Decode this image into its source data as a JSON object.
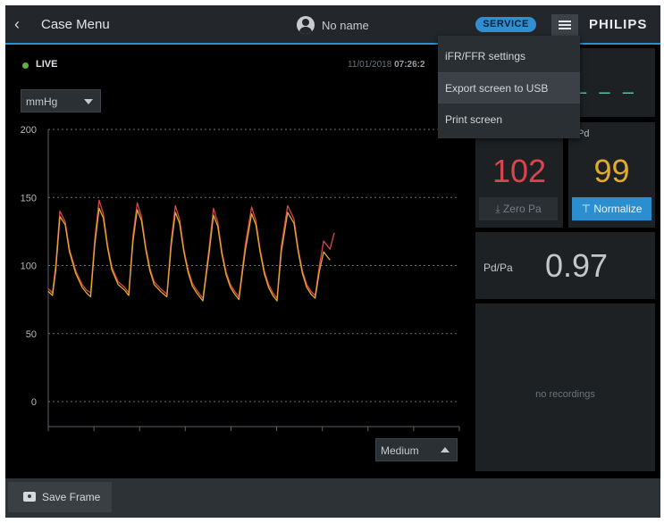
{
  "header": {
    "title": "Case Menu",
    "patient_name": "No name",
    "service_label": "SERVICE",
    "brand": "PHILIPS"
  },
  "status": {
    "live_label": "LIVE",
    "date": "11/01/2018",
    "time": "07:26:2"
  },
  "unit_select": {
    "value": "mmHg"
  },
  "speed_select": {
    "value": "Medium"
  },
  "menu": {
    "items": [
      {
        "label": "iFR/FFR settings"
      },
      {
        "label": "Export screen to USB"
      },
      {
        "label": "Print screen"
      }
    ]
  },
  "panels": {
    "top_value": "– – –",
    "pd_label": "Pd",
    "pa_value": "102",
    "pd_value": "99",
    "zero_button": "Zero Pa",
    "normalize_button": "Normalize",
    "ratio_label": "Pd/Pa",
    "ratio_value": "0.97",
    "recordings_text": "no recordings"
  },
  "footer": {
    "save_frame": "Save Frame"
  },
  "colors": {
    "accent": "#2d8fd0",
    "pa": "#d9454c",
    "pd": "#e1ac2c",
    "live": "#5fb040"
  },
  "chart_data": {
    "type": "line",
    "ylim": [
      0,
      200
    ],
    "yticks": [
      "200",
      "150",
      "100",
      "50",
      "0"
    ],
    "grid": true,
    "series": [
      {
        "color": "#d9454c",
        "x": [
          0,
          0.2,
          0.35,
          0.55,
          0.8,
          1.0,
          1.3,
          1.6,
          1.8,
          2.0,
          2.2,
          2.4,
          2.6,
          2.8,
          3.0,
          3.3,
          3.6,
          3.8,
          4.0,
          4.2,
          4.4,
          4.6,
          4.8,
          5.0,
          5.3,
          5.6,
          5.8,
          6.0,
          6.2,
          6.4,
          6.6,
          6.8,
          7.0,
          7.3,
          7.6,
          7.8,
          8.0,
          8.2,
          8.4,
          8.6,
          8.8,
          9.0,
          9.3,
          9.6,
          9.8,
          10.0,
          10.2,
          10.4,
          10.6,
          10.8,
          11.0,
          11.3,
          11.6,
          11.8,
          12.0,
          12.2,
          12.4,
          12.6,
          12.8,
          13.0,
          13.3,
          13.5
        ],
        "y": [
          83,
          80,
          100,
          140,
          132,
          112,
          96,
          86,
          82,
          80,
          120,
          148,
          138,
          115,
          99,
          88,
          84,
          80,
          122,
          146,
          136,
          114,
          98,
          88,
          83,
          79,
          118,
          144,
          134,
          112,
          97,
          87,
          82,
          76,
          114,
          142,
          132,
          110,
          95,
          86,
          81,
          77,
          115,
          143,
          133,
          112,
          96,
          86,
          80,
          76,
          114,
          144,
          134,
          112,
          96,
          86,
          81,
          78,
          100,
          118,
          112,
          124
        ]
      },
      {
        "color": "#e1ac2c",
        "x": [
          0,
          0.2,
          0.35,
          0.55,
          0.8,
          1.0,
          1.3,
          1.6,
          1.8,
          2.0,
          2.2,
          2.4,
          2.6,
          2.8,
          3.0,
          3.3,
          3.6,
          3.8,
          4.0,
          4.2,
          4.4,
          4.6,
          4.8,
          5.0,
          5.3,
          5.6,
          5.8,
          6.0,
          6.2,
          6.4,
          6.6,
          6.8,
          7.0,
          7.3,
          7.6,
          7.8,
          8.0,
          8.2,
          8.4,
          8.6,
          8.8,
          9.0,
          9.3,
          9.6,
          9.8,
          10.0,
          10.2,
          10.4,
          10.6,
          10.8,
          11.0,
          11.3,
          11.6,
          11.8,
          12.0,
          12.2,
          12.4,
          12.6,
          12.8,
          13.0,
          13.3
        ],
        "y": [
          81,
          78,
          96,
          136,
          130,
          110,
          94,
          84,
          80,
          77,
          116,
          142,
          135,
          113,
          97,
          86,
          82,
          78,
          118,
          141,
          133,
          112,
          96,
          86,
          81,
          77,
          114,
          139,
          131,
          110,
          95,
          85,
          80,
          74,
          110,
          137,
          129,
          108,
          93,
          84,
          79,
          75,
          111,
          138,
          130,
          110,
          94,
          84,
          78,
          74,
          110,
          139,
          131,
          110,
          94,
          84,
          79,
          76,
          96,
          110,
          104
        ]
      }
    ]
  }
}
